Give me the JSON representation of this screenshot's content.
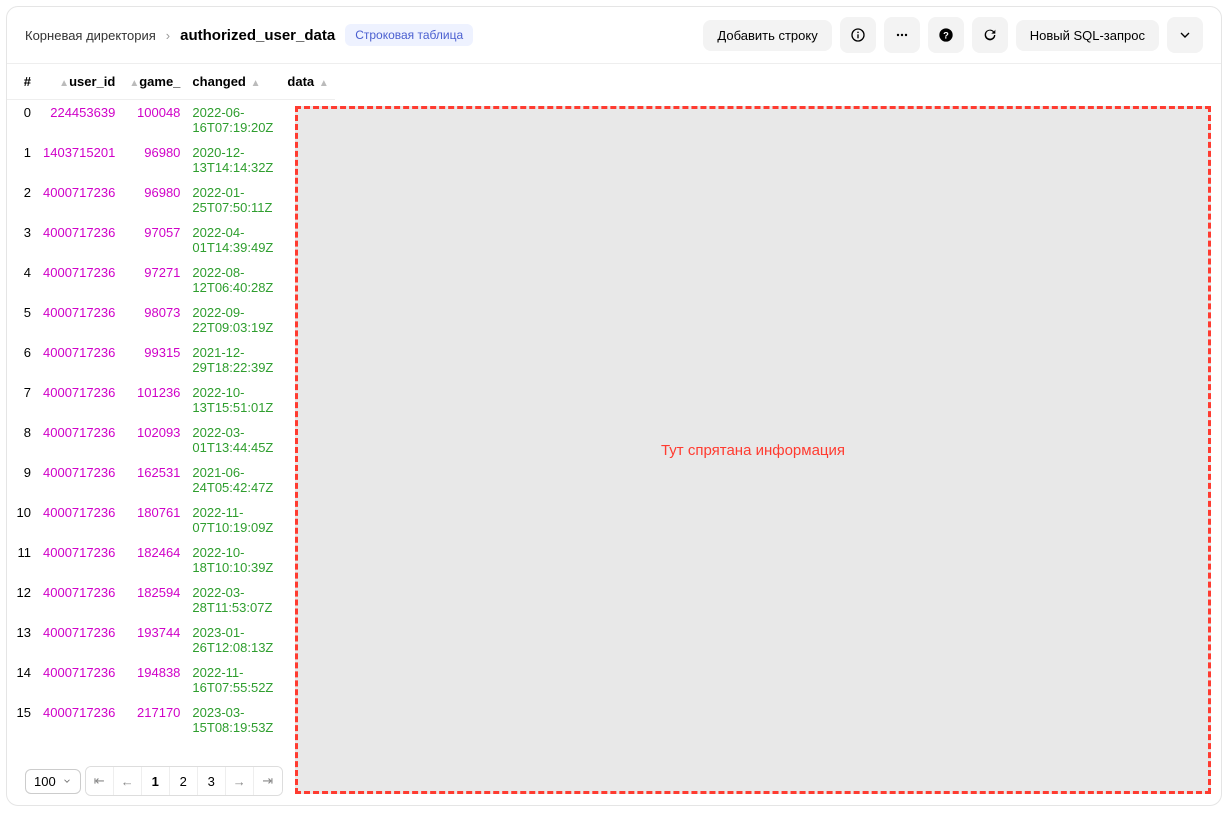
{
  "breadcrumb": {
    "root": "Корневая директория",
    "current": "authorized_user_data"
  },
  "badge": "Строковая таблица",
  "actions": {
    "add_row": "Добавить строку",
    "new_sql": "Новый SQL-запрос"
  },
  "columns": {
    "idx": "#",
    "user_id": "user_id",
    "game": "game_",
    "changed": "changed",
    "data": "data"
  },
  "rows": [
    {
      "idx": 0,
      "user_id": "224453639",
      "game": "100048",
      "changed": "2022-06-16T07:19:20Z"
    },
    {
      "idx": 1,
      "user_id": "1403715201",
      "game": "96980",
      "changed": "2020-12-13T14:14:32Z"
    },
    {
      "idx": 2,
      "user_id": "4000717236",
      "game": "96980",
      "changed": "2022-01-25T07:50:11Z"
    },
    {
      "idx": 3,
      "user_id": "4000717236",
      "game": "97057",
      "changed": "2022-04-01T14:39:49Z"
    },
    {
      "idx": 4,
      "user_id": "4000717236",
      "game": "97271",
      "changed": "2022-08-12T06:40:28Z"
    },
    {
      "idx": 5,
      "user_id": "4000717236",
      "game": "98073",
      "changed": "2022-09-22T09:03:19Z"
    },
    {
      "idx": 6,
      "user_id": "4000717236",
      "game": "99315",
      "changed": "2021-12-29T18:22:39Z"
    },
    {
      "idx": 7,
      "user_id": "4000717236",
      "game": "101236",
      "changed": "2022-10-13T15:51:01Z"
    },
    {
      "idx": 8,
      "user_id": "4000717236",
      "game": "102093",
      "changed": "2022-03-01T13:44:45Z"
    },
    {
      "idx": 9,
      "user_id": "4000717236",
      "game": "162531",
      "changed": "2021-06-24T05:42:47Z"
    },
    {
      "idx": 10,
      "user_id": "4000717236",
      "game": "180761",
      "changed": "2022-11-07T10:19:09Z"
    },
    {
      "idx": 11,
      "user_id": "4000717236",
      "game": "182464",
      "changed": "2022-10-18T10:10:39Z"
    },
    {
      "idx": 12,
      "user_id": "4000717236",
      "game": "182594",
      "changed": "2022-03-28T11:53:07Z"
    },
    {
      "idx": 13,
      "user_id": "4000717236",
      "game": "193744",
      "changed": "2023-01-26T12:08:13Z"
    },
    {
      "idx": 14,
      "user_id": "4000717236",
      "game": "194838",
      "changed": "2022-11-16T07:55:52Z"
    },
    {
      "idx": 15,
      "user_id": "4000717236",
      "game": "217170",
      "changed": "2023-03-15T08:19:53Z"
    }
  ],
  "overlay_text": "Тут спрятана информация",
  "pagination": {
    "page_size": "100",
    "pages": [
      "1",
      "2",
      "3"
    ]
  }
}
